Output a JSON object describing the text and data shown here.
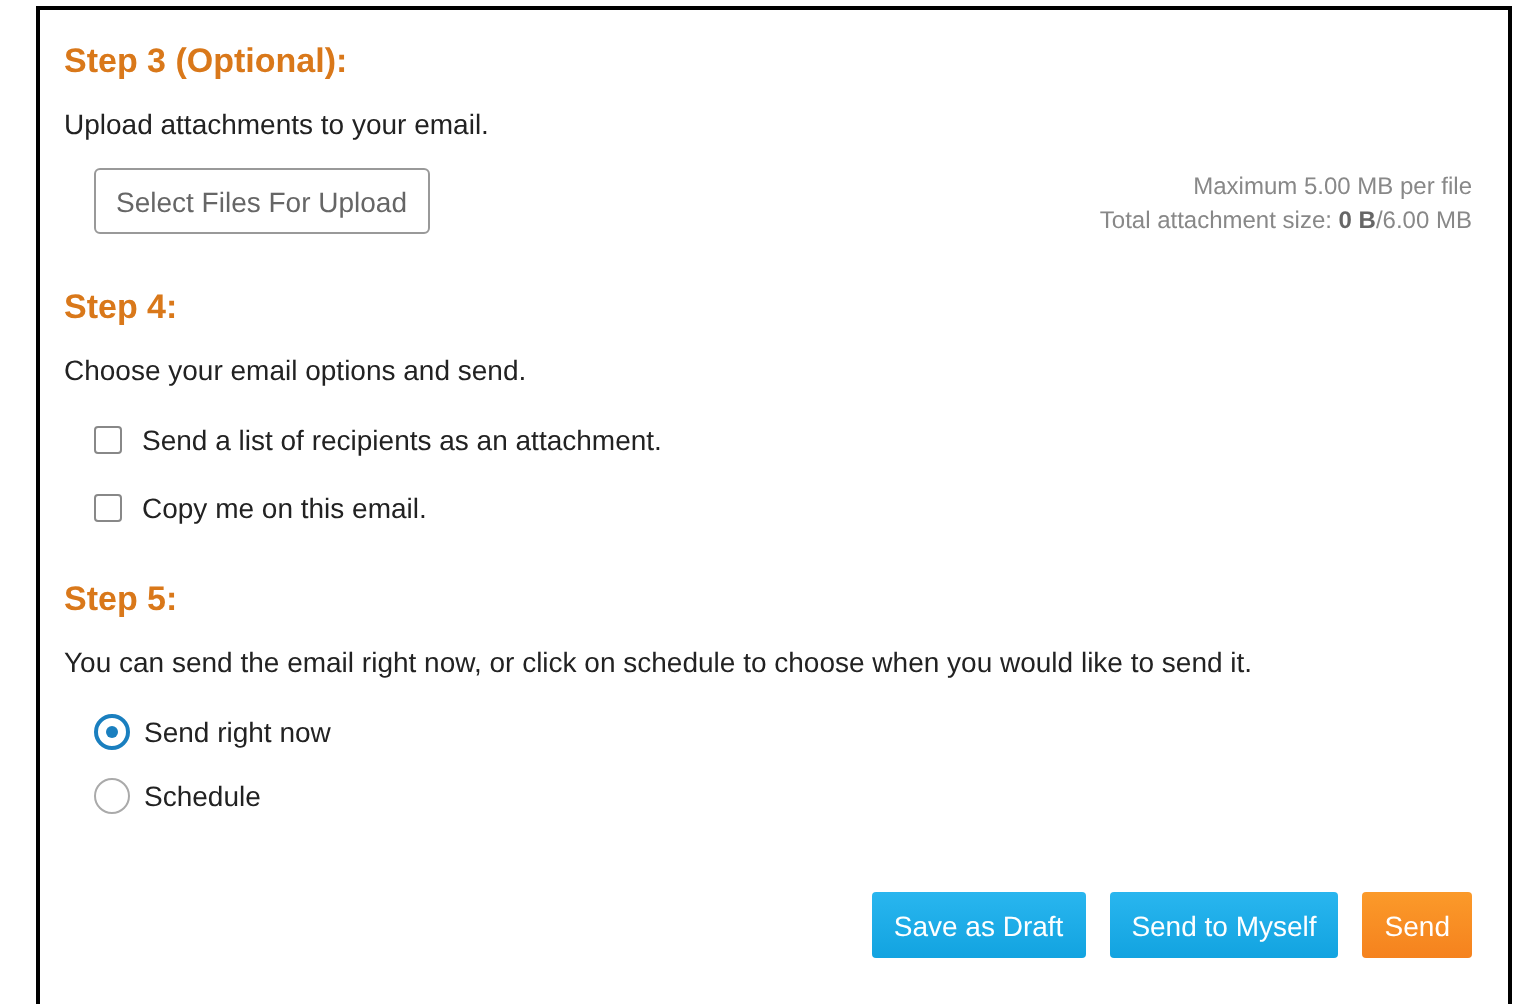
{
  "step3": {
    "heading": "Step 3 (Optional):",
    "text": "Upload attachments to your email.",
    "upload_button": "Select Files For Upload",
    "limits": [
      "Maximum 5.00 MB per file",
      "Total attachment size: **0 B**/6.00 MB"
    ]
  },
  "step4": {
    "heading": "Step 4:",
    "text": "Choose your email options and send.",
    "options": [
      {
        "label": "Send a list of recipients as an attachment.",
        "checked": false
      },
      {
        "label": "Copy me on this email.",
        "checked": false
      }
    ]
  },
  "step5": {
    "heading": "Step 5:",
    "text": "You can send the email right now, or click on schedule to choose when you would like to send it.",
    "choices": [
      {
        "label": "Send right now",
        "selected": true
      },
      {
        "label": "Schedule",
        "selected": false
      }
    ]
  },
  "buttons": [
    {
      "label": "Save as Draft",
      "kind": "secondary"
    },
    {
      "label": "Send to Myself",
      "kind": "secondary"
    },
    {
      "label": "Send",
      "kind": "primary"
    }
  ]
}
